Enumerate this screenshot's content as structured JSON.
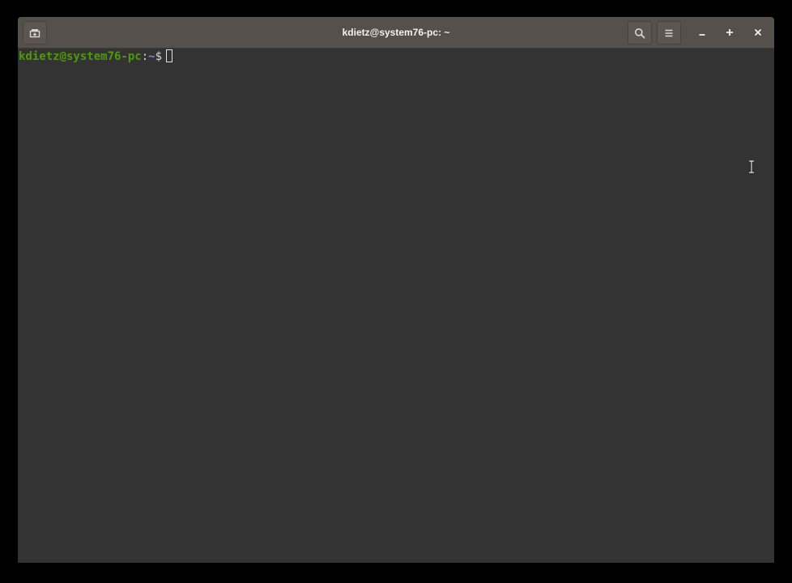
{
  "window": {
    "title": "kdietz@system76-pc: ~"
  },
  "titlebar": {
    "new_tab_icon": "new-tab-icon",
    "search_icon": "search-icon",
    "menu_icon": "hamburger-menu-icon",
    "minimize_icon": "minimize-icon",
    "maximize_icon": "maximize-icon",
    "close_icon": "close-icon"
  },
  "terminal": {
    "prompt_user_host": "kdietz@system76-pc",
    "prompt_separator": ":",
    "prompt_path": "~",
    "prompt_symbol": "$",
    "input_text": "",
    "colors": {
      "background": "#333333",
      "user_host": "#4e9a06",
      "path": "#6b8fd0",
      "text": "#d3d7cf"
    }
  },
  "pointer": {
    "icon": "text-cursor-ibeam-icon"
  }
}
